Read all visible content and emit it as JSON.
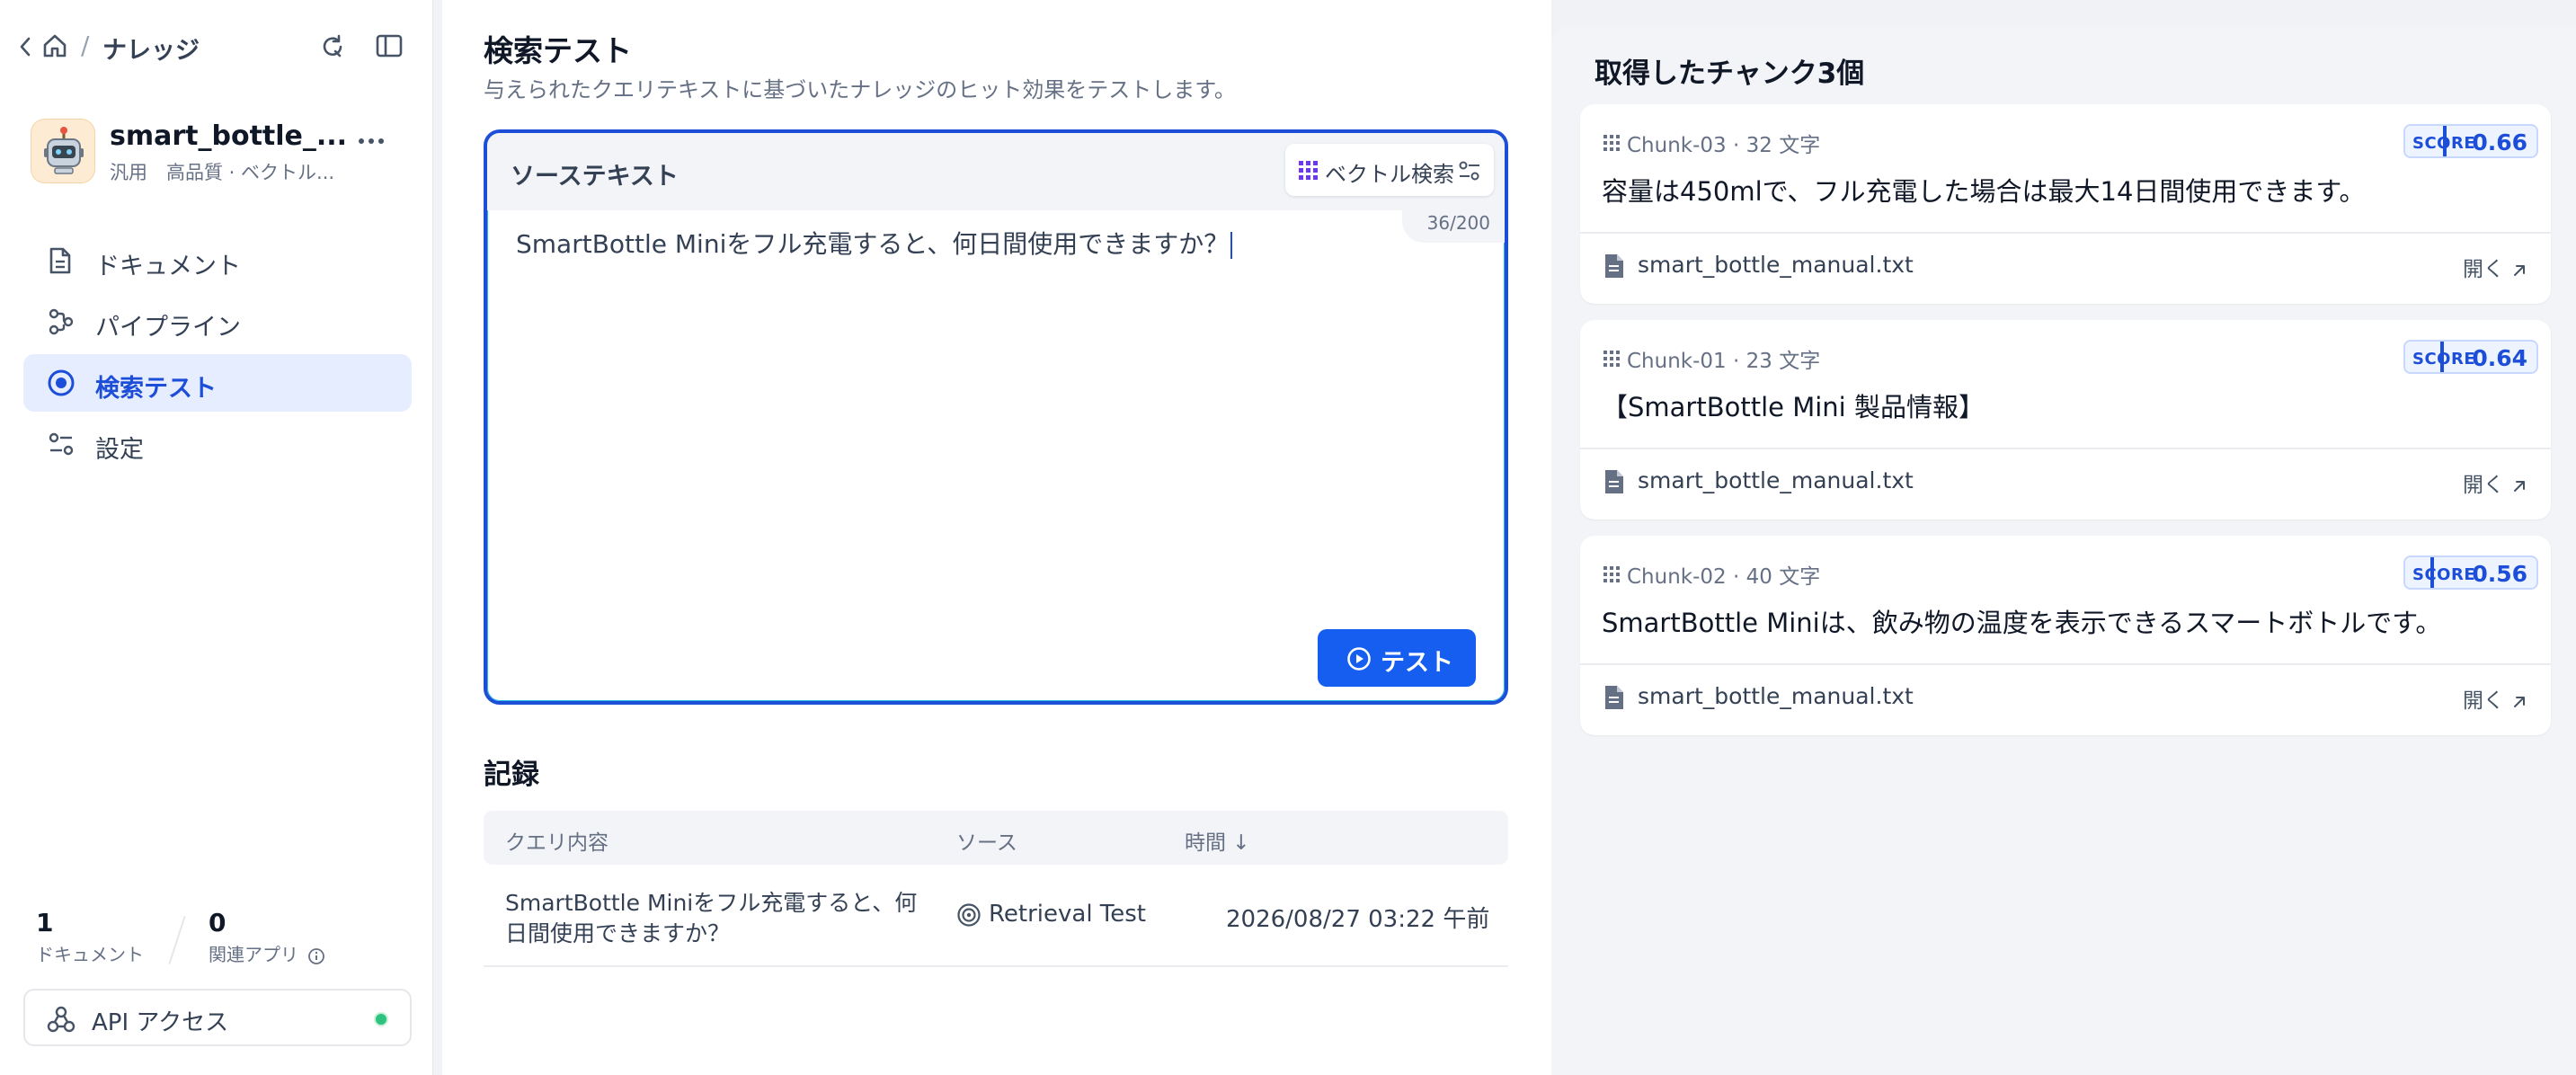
{
  "nav": {
    "breadcrumb_label": "ナレッジ",
    "kb_name": "smart_bottle_...",
    "kb_meta": "汎用　高品質 · ベクトル...",
    "items": [
      {
        "label": "ドキュメント",
        "icon": "document-icon"
      },
      {
        "label": "パイプライン",
        "icon": "pipeline-icon"
      },
      {
        "label": "検索テスト",
        "icon": "target-icon",
        "active": true
      },
      {
        "label": "設定",
        "icon": "settings-icon"
      }
    ],
    "stats": {
      "documents_count": "1",
      "documents_label": "ドキュメント",
      "apps_count": "0",
      "apps_label": "関連アプリ"
    },
    "api_access_label": "API アクセス",
    "api_status_color": "#2ec27e"
  },
  "main": {
    "title": "検索テスト",
    "description": "与えられたクエリテキストに基づいたナレッジのヒット効果をテストします。",
    "source": {
      "title": "ソーステキスト",
      "method_label": "ベクトル検索",
      "counter": "36/200",
      "query": "SmartBottle Miniをフル充電すると、何日間使用できますか？",
      "test_button": "テスト"
    },
    "records": {
      "title": "記録",
      "columns": [
        "クエリ内容",
        "ソース",
        "時間 ↓"
      ],
      "rows": [
        {
          "query": "SmartBottle Miniをフル充電すると、何日間使用できますか？",
          "source": "Retrieval Test",
          "time": "2026/08/27 03:22 午前"
        }
      ]
    }
  },
  "results": {
    "title": "取得したチャンク3個",
    "score_label": "SCORE",
    "open_label": "開く",
    "chunks": [
      {
        "id": "Chunk-03",
        "chars": "32 文字",
        "score": "0.66",
        "score_value": 0.66,
        "content": "容量は450mlで、フル充電した場合は最大14日間使用できます。",
        "file": "smart_bottle_manual.txt"
      },
      {
        "id": "Chunk-01",
        "chars": "23 文字",
        "score": "0.64",
        "score_value": 0.64,
        "content": "【SmartBottle Mini 製品情報】",
        "file": "smart_bottle_manual.txt"
      },
      {
        "id": "Chunk-02",
        "chars": "40 文字",
        "score": "0.56",
        "score_value": 0.56,
        "content": "SmartBottle Miniは、飲み物の温度を表示できるスマートボトルです。",
        "file": "smart_bottle_manual.txt"
      }
    ]
  },
  "colors": {
    "accent": "#155eef",
    "active_nav_bg": "#e6edff",
    "score_bg": "#eef4ff"
  }
}
